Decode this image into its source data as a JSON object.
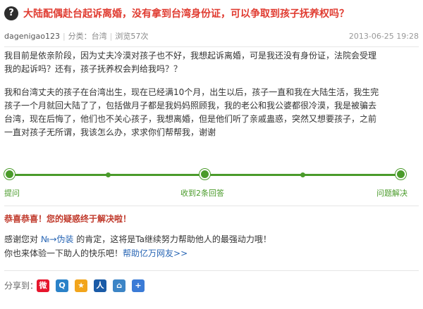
{
  "question": {
    "icon_glyph": "?",
    "title": "大陆配偶赴台起诉离婚，没有拿到台湾身份证，可以争取到孩子抚养权吗？",
    "author": "dagenigao123",
    "category": "分类：台湾",
    "views": "浏览57次",
    "time": "2013-06-25 19:28",
    "para1": [
      "我目前是依亲阶段，因为丈夫冷漠对孩子也不好，我想起诉离婚，可是我还没有身份证，法院会受理",
      "我的起诉吗？还有，孩子抚养权会判给我吗？？"
    ],
    "para2": [
      "我和台湾丈夫的孩子在台湾出生，现在已经满10个月，出生以后，孩子一直和我在大陆生活，我生完",
      "孩子一个月就回大陆了了，包括做月子都是我妈妈照顾我，我的老公和我公婆都很冷漠，我是被骗去",
      "台湾，现在后悔了，他们也不关心孩子，我想离婚，但是他们听了亲戚蛊惑，突然又想要孩子，之前",
      "一直对孩子无所谓，我该怎么办，求求你们帮帮我，谢谢"
    ]
  },
  "progress": {
    "steps": [
      {
        "label": "提问"
      },
      {
        "label": "收到2条回答"
      },
      {
        "label": "问题解决"
      }
    ],
    "color": "#4a9b2a"
  },
  "resolution": {
    "heading": "恭喜恭喜！您的疑惑终于解决啦！",
    "thanks_prefix": "感谢您对",
    "thanks_user": "№→伪装",
    "thanks_suffix": "的肯定，这将是Ta继续努力帮助他人的最强动力哦！",
    "invite_prefix": "你也来体验一下助人的快乐吧！",
    "invite_link": "帮助亿万网友>>"
  },
  "share": {
    "label": "分享到：",
    "targets": [
      {
        "icon": "weibo-icon",
        "glyph": "微",
        "color": "#e6162d"
      },
      {
        "icon": "qzone-icon",
        "glyph": "Q",
        "color": "#2b82c8"
      },
      {
        "icon": "star-icon",
        "glyph": "★",
        "color": "#f2a51c"
      },
      {
        "icon": "renren-icon",
        "glyph": "人",
        "color": "#1a5ba7"
      },
      {
        "icon": "bookmark-icon",
        "glyph": "⌂",
        "color": "#3d85c6"
      },
      {
        "icon": "more-icon",
        "glyph": "+",
        "color": "#3b7bd6"
      }
    ]
  }
}
